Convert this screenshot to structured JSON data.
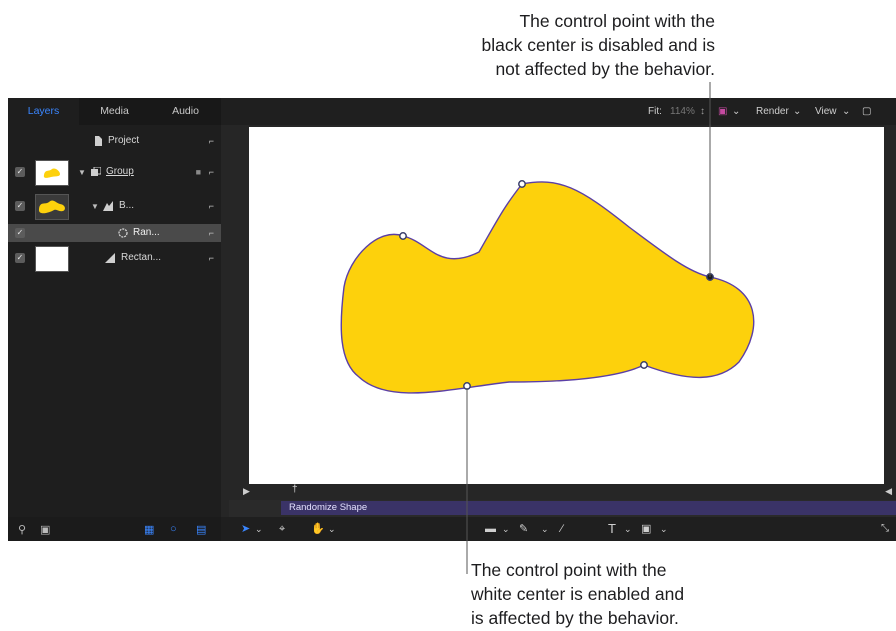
{
  "callouts": {
    "top": [
      "The control point with the",
      "black center is disabled and is",
      "not affected by the behavior."
    ],
    "bottom": [
      "The control point with the",
      "white center is enabled and",
      "is affected by the behavior."
    ]
  },
  "tabs": [
    "Layers",
    "Media",
    "Audio"
  ],
  "project_label": "Project",
  "layers": [
    {
      "label": "Group",
      "checked": true
    },
    {
      "label": "B...",
      "checked": true
    },
    {
      "label": "Ran...",
      "checked": true
    },
    {
      "label": "Rectan...",
      "checked": true
    }
  ],
  "toolbar": {
    "fit_label": "Fit:",
    "fit_value": "114%",
    "render_label": "Render",
    "view_label": "View"
  },
  "timeline": {
    "clip_label": "Randomize Shape"
  },
  "colors": {
    "shape_fill": "#fdd10c",
    "shape_stroke": "#5b3fa6",
    "accent": "#3a86ff"
  },
  "icons": [
    "document-icon",
    "lock-icon",
    "group-icon",
    "shape-icon",
    "randomize-behavior-icon",
    "rectangle-icon",
    "search-icon",
    "arrow-tool-icon",
    "transform-icon",
    "hand-icon",
    "rectangle-tool-icon",
    "pen-icon",
    "brush-icon",
    "text-icon",
    "mask-icon"
  ]
}
